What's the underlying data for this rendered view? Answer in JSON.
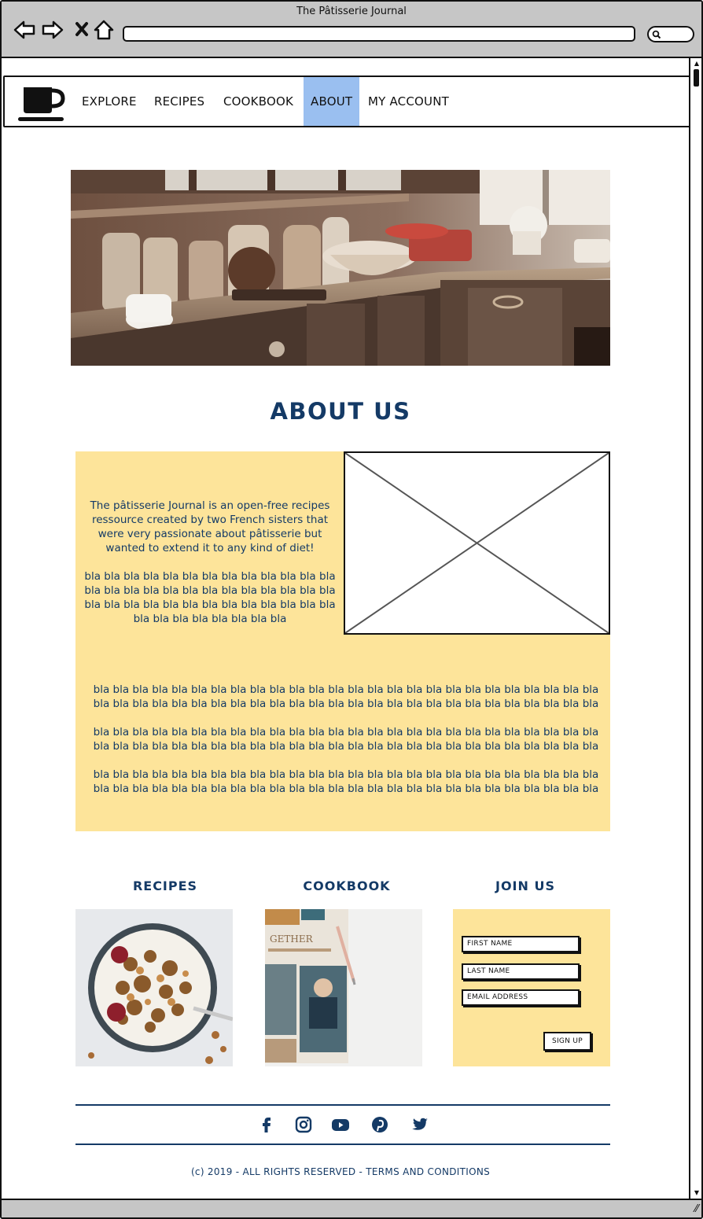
{
  "browser": {
    "title": "The Pâtisserie Journal",
    "url": ""
  },
  "nav": {
    "logo_icon": "coffee-cup-icon",
    "items": [
      {
        "label": "EXPLORE",
        "active": false
      },
      {
        "label": "RECIPES",
        "active": false
      },
      {
        "label": "COOKBOOK",
        "active": false
      },
      {
        "label": "ABOUT",
        "active": true
      },
      {
        "label": "MY ACCOUNT",
        "active": false
      }
    ],
    "active_color": "#9abff0"
  },
  "about": {
    "title": "ABOUT US",
    "intro": "The pâtisserie Journal is an open-free recipes ressource created by two French sisters that were very passionate about pâtisserie but wanted to extend it to any kind of diet!",
    "intro_filler": "bla bla bla bla  bla bla bla bla  bla bla bla bla bla bla bla  bla bla bla bla  bla bla bla bla  bla bla bla bla  bla bla bla bla  bla bla bla bla  bla bla bla bla  bla bla bla bla  bla bla bla bla",
    "paragraphs": [
      "bla bla bla bla  bla bla bla bla  bla bla bla bla  bla bla bla bla  bla bla bla bla  bla bla bla bla  bla bla bla bla  bla bla bla bla  bla bla bla bla  bla bla bla bla  bla bla bla bla  bla bla bla bla  bla bla bla bla",
      "bla bla bla bla  bla bla bla bla  bla bla bla bla  bla bla bla bla  bla bla bla bla  bla bla bla bla  bla bla bla bla  bla bla bla bla  bla bla bla bla  bla bla bla bla  bla bla bla bla  bla bla bla bla  bla bla bla bla",
      "bla bla bla bla  bla bla bla bla  bla bla bla bla  bla bla bla bla  bla bla bla bla  bla bla bla bla  bla bla bla bla  bla bla bla bla  bla bla bla bla  bla bla bla bla  bla bla bla bla  bla bla bla bla  bla bla bla bla"
    ],
    "box_color": "#fde49a",
    "title_color": "#143a66"
  },
  "columns": {
    "recipes_title": "RECIPES",
    "cookbook_title": "COOKBOOK",
    "join_title": "JOIN US"
  },
  "join_form": {
    "first_name": "FIRST NAME",
    "last_name": "LAST NAME",
    "email": "EMAIL ADDRESS",
    "button": "SIGN UP"
  },
  "footer": {
    "social_icons": [
      "facebook-icon",
      "instagram-icon",
      "youtube-icon",
      "pinterest-icon",
      "twitter-icon"
    ],
    "text": "(c) 2019 - ALL RIGHTS RESERVED - TERMS AND CONDITIONS"
  }
}
